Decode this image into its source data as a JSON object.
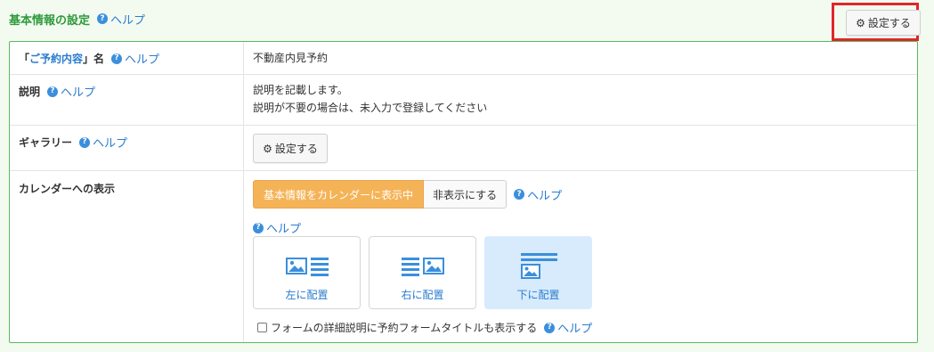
{
  "header": {
    "title": "基本情報の設定",
    "help": "ヘルプ",
    "settings_button": "設定する"
  },
  "rows": {
    "name": {
      "quote_open": "「",
      "emph": "ご予約内容",
      "quote_close": "」名",
      "help": "ヘルプ",
      "value": "不動産内見予約"
    },
    "description": {
      "label": "説明",
      "help": "ヘルプ",
      "line1": "説明を記載します。",
      "line2": "説明が不要の場合は、未入力で登録してください"
    },
    "gallery": {
      "label": "ギャラリー",
      "help": "ヘルプ",
      "button": "設定する"
    },
    "calendar": {
      "label": "カレンダーへの表示",
      "toggle_on": "基本情報をカレンダーに表示中",
      "toggle_off": "非表示にする",
      "help1": "ヘルプ",
      "help2": "ヘルプ",
      "layouts": [
        {
          "label": "左に配置",
          "icon": "image-left-icon",
          "selected": false
        },
        {
          "label": "右に配置",
          "icon": "image-right-icon",
          "selected": false
        },
        {
          "label": "下に配置",
          "icon": "image-bottom-icon",
          "selected": true
        }
      ],
      "checkbox_label": "フォームの詳細説明に予約フォームタイトルも表示する",
      "checkbox_checked": false,
      "help3": "ヘルプ"
    }
  },
  "colors": {
    "accent_green": "#2e9a3a",
    "link_blue": "#2a7ccf",
    "toggle_orange": "#f5b357",
    "selected_bg": "#d8ebfc",
    "highlight_red": "#e0262b"
  }
}
